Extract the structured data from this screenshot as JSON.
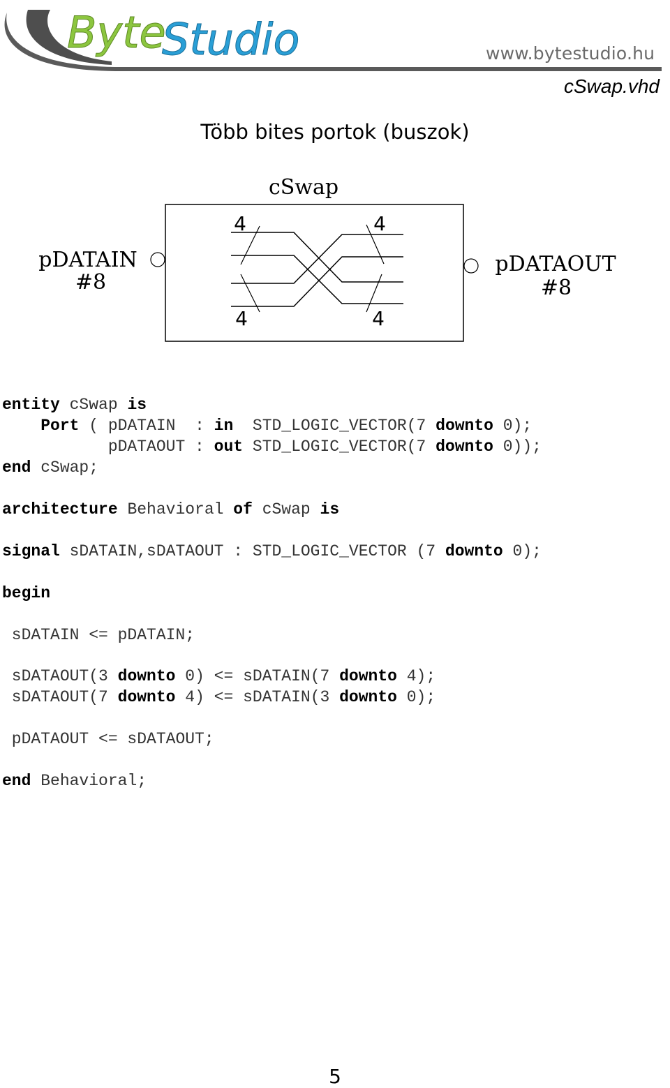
{
  "header": {
    "logo_text_part1": "Byte",
    "logo_text_part2": "Studio",
    "site_url": "www.bytestudio.hu",
    "file_name": "cSwap.vhd",
    "brand_colors": {
      "green": "#8cc63f",
      "blue": "#2a9fd6",
      "gray": "#555555"
    }
  },
  "page_title": "Több bites portok (buszok)",
  "diagram": {
    "entity_name": "cSwap",
    "input_port": {
      "name": "pDATAIN",
      "width": "#8"
    },
    "output_port": {
      "name": "pDATAOUT",
      "width": "#8"
    },
    "bus_counts": {
      "in_top": "4",
      "in_bottom": "4",
      "out_top": "4",
      "out_bottom": "4"
    }
  },
  "code": {
    "lines": [
      {
        "segments": [
          {
            "t": "entity",
            "kw": true
          },
          {
            "t": " cSwap "
          },
          {
            "t": "is",
            "kw": true
          }
        ]
      },
      {
        "segments": [
          {
            "t": "    "
          },
          {
            "t": "Port",
            "kw": true
          },
          {
            "t": " ( pDATAIN  : "
          },
          {
            "t": "in",
            "kw": true
          },
          {
            "t": "  STD_LOGIC_VECTOR(7 "
          },
          {
            "t": "downto",
            "kw": true
          },
          {
            "t": " 0);"
          }
        ]
      },
      {
        "segments": [
          {
            "t": "           pDATAOUT : "
          },
          {
            "t": "out",
            "kw": true
          },
          {
            "t": " STD_LOGIC_VECTOR(7 "
          },
          {
            "t": "downto",
            "kw": true
          },
          {
            "t": " 0));"
          }
        ]
      },
      {
        "segments": [
          {
            "t": "end",
            "kw": true
          },
          {
            "t": " cSwap;"
          }
        ]
      },
      {
        "segments": [
          {
            "t": "architecture",
            "kw": true
          },
          {
            "t": " Behavioral "
          },
          {
            "t": "of",
            "kw": true
          },
          {
            "t": " cSwap "
          },
          {
            "t": "is",
            "kw": true
          }
        ]
      },
      {
        "segments": [
          {
            "t": "signal",
            "kw": true
          },
          {
            "t": " sDATAIN,sDATAOUT : STD_LOGIC_VECTOR (7 "
          },
          {
            "t": "downto",
            "kw": true
          },
          {
            "t": " 0);"
          }
        ]
      },
      {
        "segments": [
          {
            "t": "begin",
            "kw": true
          }
        ]
      },
      {
        "segments": [
          {
            "t": " sDATAIN <= pDATAIN;"
          }
        ]
      },
      {
        "segments": [
          {
            "t": " sDATAOUT(3 "
          },
          {
            "t": "downto",
            "kw": true
          },
          {
            "t": " 0) <= sDATAIN(7 "
          },
          {
            "t": "downto",
            "kw": true
          },
          {
            "t": " 4);"
          }
        ]
      },
      {
        "segments": [
          {
            "t": " sDATAOUT(7 "
          },
          {
            "t": "downto",
            "kw": true
          },
          {
            "t": " 4) <= sDATAIN(3 "
          },
          {
            "t": "downto",
            "kw": true
          },
          {
            "t": " 0);"
          }
        ]
      },
      {
        "segments": [
          {
            "t": " pDATAOUT <= sDATAOUT;"
          }
        ]
      },
      {
        "segments": [
          {
            "t": "end",
            "kw": true
          },
          {
            "t": " Behavioral;"
          }
        ]
      }
    ]
  },
  "page_number": "5"
}
